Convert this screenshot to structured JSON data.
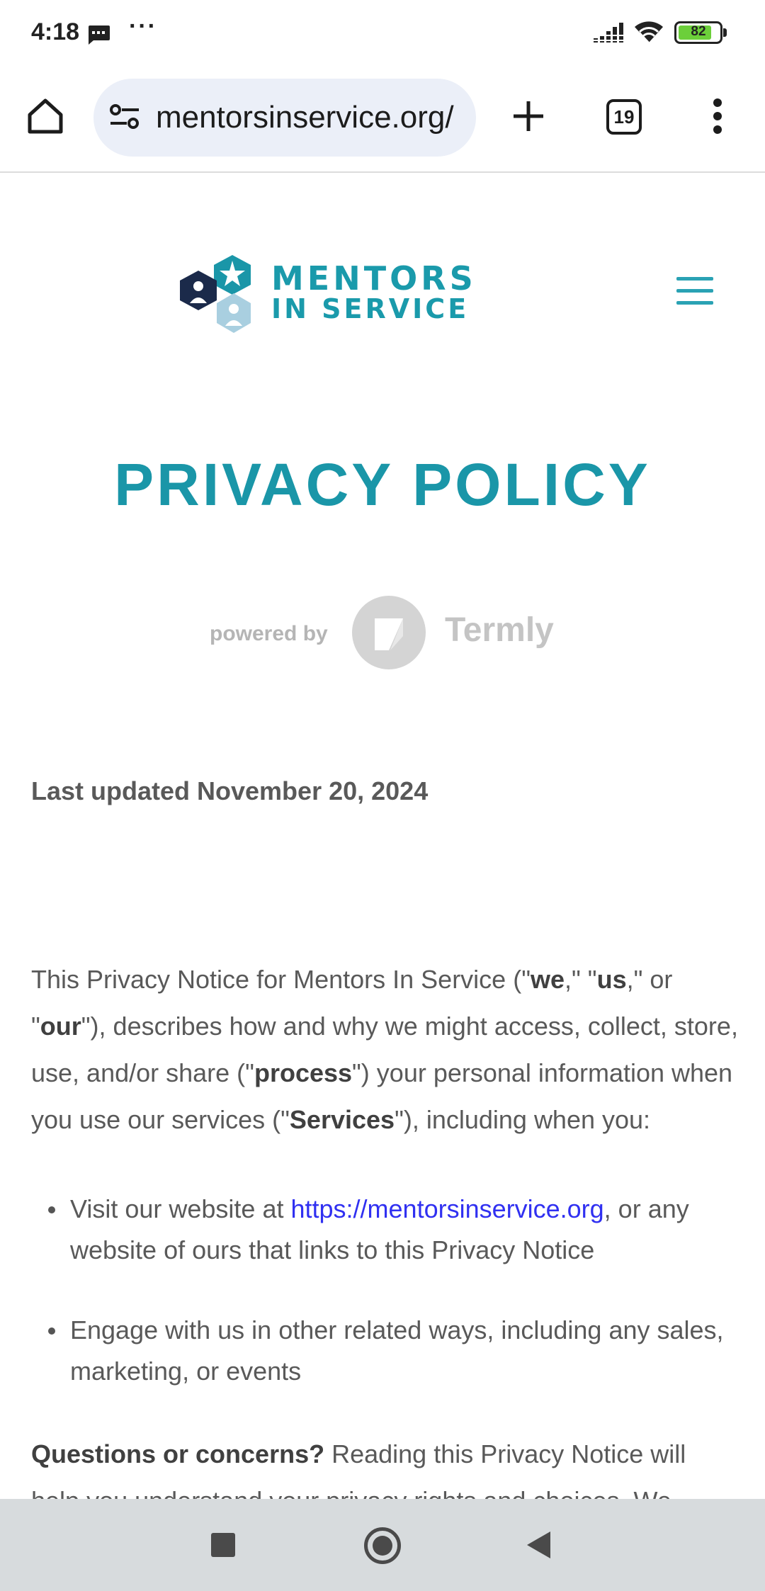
{
  "status_bar": {
    "time": "4:18",
    "more": "···",
    "battery_level": 82,
    "battery_label": "82",
    "icons": [
      "message-icon",
      "signal-icon",
      "wifi-icon",
      "battery-icon"
    ]
  },
  "browser": {
    "url": "mentorsinservice.org/",
    "tab_count": "19",
    "icons": [
      "home-icon",
      "tune-icon",
      "plus-icon",
      "tabs-icon",
      "more-vert-icon"
    ]
  },
  "site": {
    "logo_line1": "MENTORS",
    "logo_line2": "IN SERVICE",
    "colors": {
      "brand": "#1a96a8",
      "navy": "#1b2a4a",
      "light": "#a9cfe0"
    }
  },
  "page": {
    "title": "PRIVACY POLICY",
    "powered_by": "powered by",
    "termly": "Termly",
    "last_updated": "Last updated November 20, 2024",
    "intro": {
      "t1": "This Privacy Notice for Mentors In Service (\"",
      "b1": "we",
      "t2": ",\" \"",
      "b2": "us",
      "t3": ",\" or \"",
      "b3": "our",
      "t4": "\"), describes how and why we might access, collect, store, use, and/or share (\"",
      "b4": "process",
      "t5": "\") your personal information when you use our services (\"",
      "b5": "Services",
      "t6": "\"), including when you:"
    },
    "bullets": [
      {
        "before": "Visit our website at ",
        "link": "https://mentorsinservice.org",
        "after": ", or any website of ours that links to this Privacy Notice"
      },
      {
        "text": "Engage with us in other related ways, including any sales, marketing, or events"
      }
    ],
    "questions_label": "Questions or concerns?",
    "questions_text": " Reading this Privacy Notice will help you understand your privacy rights and choices. We",
    "link_color": "#3030f1"
  },
  "nav_bar": {
    "icons": [
      "recents-icon",
      "home-circle-icon",
      "back-icon"
    ]
  }
}
